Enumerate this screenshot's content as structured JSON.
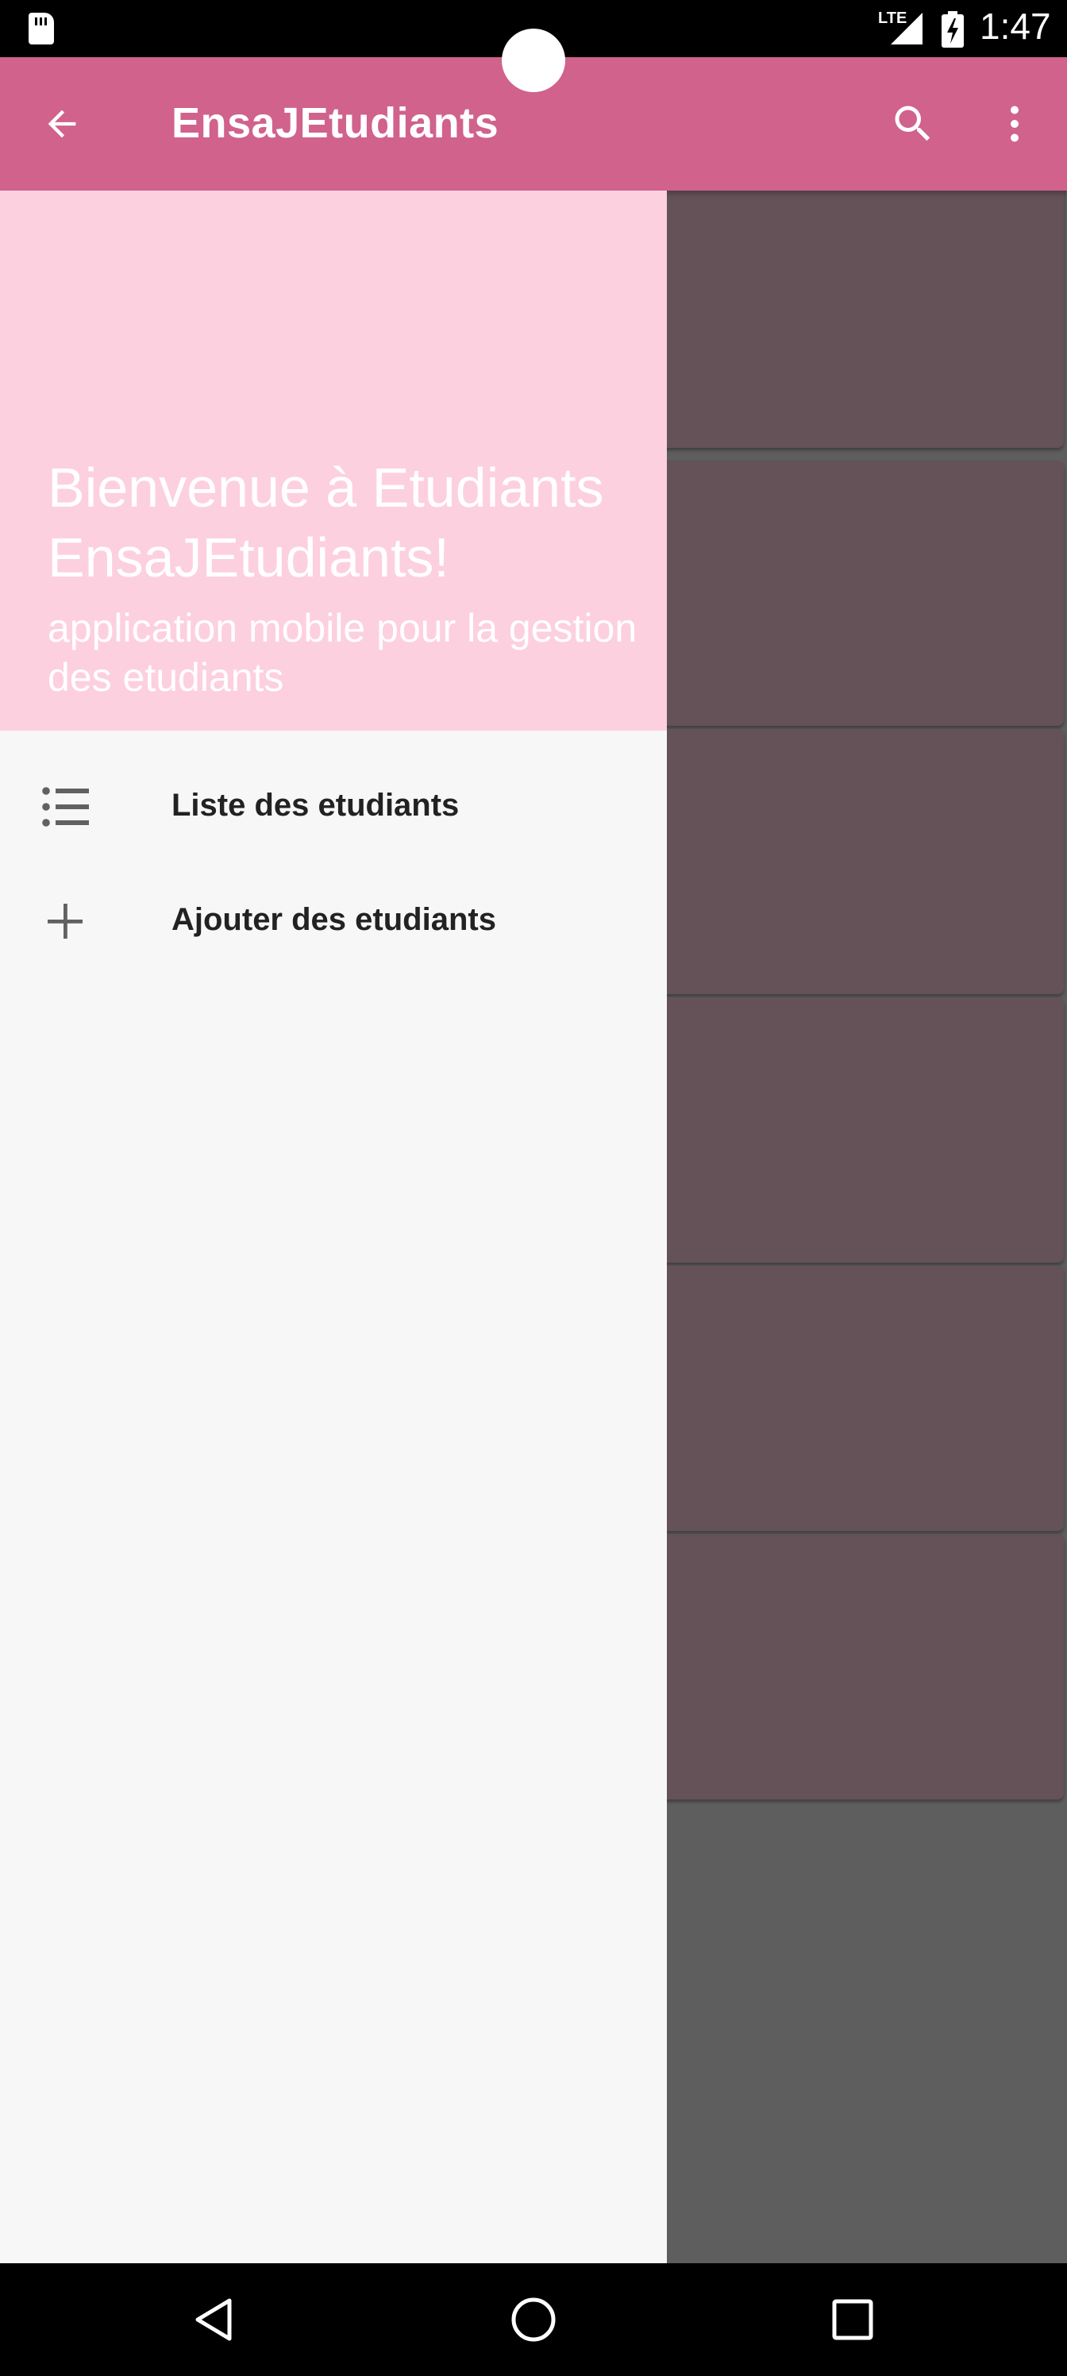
{
  "status_bar": {
    "network": "LTE",
    "time": "1:47",
    "icons": [
      "sd-card-icon",
      "signal-icon",
      "battery-charging-icon"
    ]
  },
  "app_bar": {
    "title": "EnsaJEtudiants",
    "icons": [
      "back-arrow-icon",
      "search-icon",
      "more-vert-icon"
    ]
  },
  "drawer": {
    "header": {
      "title": "Bienvenue à Etudiants EnsaJEtudiants!",
      "subtitle": "application mobile pour la gestion des etudiants"
    },
    "items": [
      {
        "label": "Liste des etudiants",
        "icon": "list-icon"
      },
      {
        "label": "Ajouter des etudiants",
        "icon": "add-icon"
      }
    ]
  },
  "nav_bar": {
    "icons": [
      "back-nav-icon",
      "home-nav-icon",
      "recents-nav-icon"
    ]
  },
  "colors": {
    "primary": "#d0628c",
    "drawer_header": "#fdd0df",
    "drawer_bg": "#f7f7f7",
    "scrim_card": "#645258",
    "scrim_bg": "#5e5e5e"
  }
}
